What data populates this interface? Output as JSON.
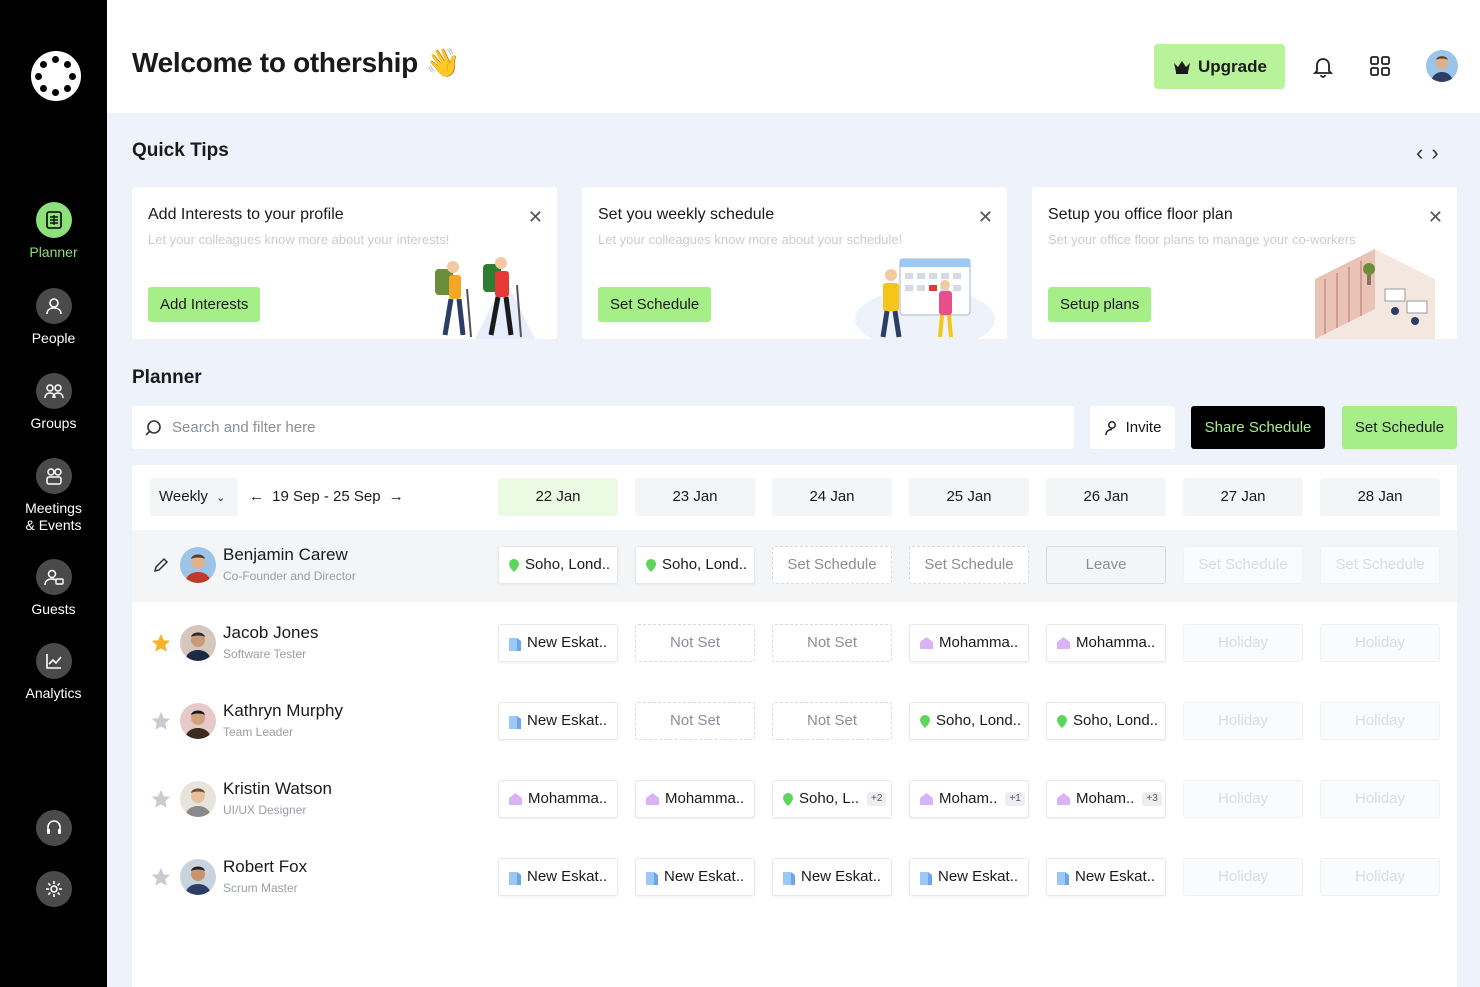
{
  "sidebar": {
    "items": [
      {
        "label": "Planner",
        "icon": "planner-icon"
      },
      {
        "label": "People",
        "icon": "person-icon"
      },
      {
        "label": "Groups",
        "icon": "groups-icon"
      },
      {
        "label": "Meetings & Events",
        "icon": "meetings-icon"
      },
      {
        "label": "Guests",
        "icon": "guests-icon"
      },
      {
        "label": "Analytics",
        "icon": "analytics-icon"
      }
    ],
    "bottom": [
      {
        "icon": "headset-icon"
      },
      {
        "icon": "gear-icon"
      }
    ]
  },
  "header": {
    "title": "Welcome to othership",
    "wave": "👋",
    "upgrade_label": "Upgrade"
  },
  "quick_tips": {
    "title": "Quick Tips",
    "cards": [
      {
        "title": "Add Interests to your profile",
        "desc": "Let your colleagues know more about your interests!",
        "button": "Add Interests"
      },
      {
        "title": "Set you weekly schedule",
        "desc": "Let your colleagues know more about your schedule!",
        "button": "Set Schedule"
      },
      {
        "title": "Setup you office floor plan",
        "desc": "Set your office floor plans to manage your co-workers",
        "button": "Setup plans"
      }
    ]
  },
  "planner": {
    "title": "Planner",
    "search_placeholder": "Search and filter here",
    "invite_label": "Invite",
    "share_label": "Share Schedule",
    "set_label": "Set Schedule",
    "view": "Weekly",
    "range": "19 Sep - 25 Sep",
    "days": [
      "22 Jan",
      "23 Jan",
      "24 Jan",
      "25 Jan",
      "26 Jan",
      "27 Jan",
      "28 Jan"
    ],
    "rows": [
      {
        "name": "Benjamin Carew",
        "role": "Co-Founder and Director",
        "lead": "pencil",
        "cells": [
          {
            "kind": "loc",
            "pin": "green",
            "text": "Soho, Lond.."
          },
          {
            "kind": "loc",
            "pin": "green",
            "text": "Soho, Lond.."
          },
          {
            "kind": "dash",
            "text": "Set Schedule"
          },
          {
            "kind": "dash",
            "text": "Set Schedule"
          },
          {
            "kind": "leave",
            "text": "Leave"
          },
          {
            "kind": "faded",
            "text": "Set Schedule"
          },
          {
            "kind": "faded",
            "text": "Set Schedule"
          }
        ]
      },
      {
        "name": "Jacob Jones",
        "role": "Software Tester",
        "lead": "star-filled",
        "cells": [
          {
            "kind": "loc",
            "pin": "blue",
            "text": "New Eskat.."
          },
          {
            "kind": "dash",
            "text": "Not Set"
          },
          {
            "kind": "dash",
            "text": "Not Set"
          },
          {
            "kind": "loc",
            "pin": "purple",
            "text": "Mohamma.."
          },
          {
            "kind": "loc",
            "pin": "purple",
            "text": "Mohamma.."
          },
          {
            "kind": "faded",
            "text": "Holiday"
          },
          {
            "kind": "faded",
            "text": "Holiday"
          }
        ]
      },
      {
        "name": "Kathryn Murphy",
        "role": "Team Leader",
        "lead": "star",
        "cells": [
          {
            "kind": "loc",
            "pin": "blue",
            "text": "New Eskat.."
          },
          {
            "kind": "dash",
            "text": "Not Set"
          },
          {
            "kind": "dash",
            "text": "Not Set"
          },
          {
            "kind": "loc",
            "pin": "green",
            "text": "Soho, Lond.."
          },
          {
            "kind": "loc",
            "pin": "green",
            "text": "Soho, Lond.."
          },
          {
            "kind": "faded",
            "text": "Holiday"
          },
          {
            "kind": "faded",
            "text": "Holiday"
          }
        ]
      },
      {
        "name": "Kristin Watson",
        "role": "UI/UX Designer",
        "lead": "star",
        "cells": [
          {
            "kind": "loc",
            "pin": "purple",
            "text": "Mohamma.."
          },
          {
            "kind": "loc",
            "pin": "purple",
            "text": "Mohamma.."
          },
          {
            "kind": "loc",
            "pin": "green",
            "text": "Soho, L..",
            "badge": "+2"
          },
          {
            "kind": "loc",
            "pin": "purple",
            "text": "Moham..",
            "badge": "+1"
          },
          {
            "kind": "loc",
            "pin": "purple",
            "text": "Moham..",
            "badge": "+3"
          },
          {
            "kind": "faded",
            "text": "Holiday"
          },
          {
            "kind": "faded",
            "text": "Holiday"
          }
        ]
      },
      {
        "name": "Robert Fox",
        "role": "Scrum Master",
        "lead": "star",
        "cells": [
          {
            "kind": "loc",
            "pin": "blue",
            "text": "New Eskat.."
          },
          {
            "kind": "loc",
            "pin": "blue",
            "text": "New Eskat.."
          },
          {
            "kind": "loc",
            "pin": "blue",
            "text": "New Eskat.."
          },
          {
            "kind": "loc",
            "pin": "blue",
            "text": "New Eskat.."
          },
          {
            "kind": "loc",
            "pin": "blue",
            "text": "New Eskat.."
          },
          {
            "kind": "faded",
            "text": "Holiday"
          },
          {
            "kind": "faded",
            "text": "Holiday"
          }
        ]
      }
    ]
  },
  "colors": {
    "accent": "#a6ee88",
    "sidebar_bg": "#000000",
    "page_bg": "#eef3fb",
    "star": "#f7b32b",
    "pin_green": "#5cd65c",
    "pin_blue": "#9cc8f5",
    "pin_purple": "#d9b3f5"
  }
}
